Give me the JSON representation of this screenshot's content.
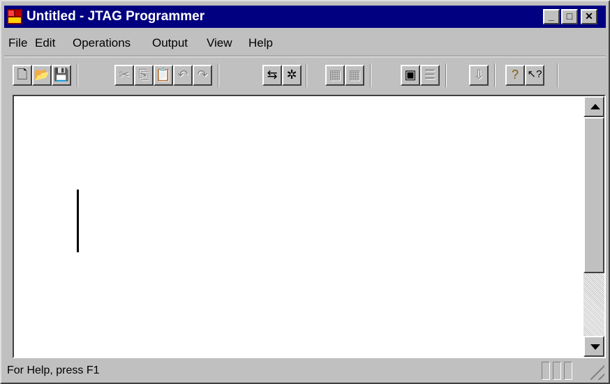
{
  "window": {
    "title": "Untitled - JTAG Programmer"
  },
  "title_buttons": {
    "minimize": "_",
    "maximize": "□",
    "close": "✕"
  },
  "menu": [
    {
      "label": "File"
    },
    {
      "label": "Edit"
    },
    {
      "label": "Operations"
    },
    {
      "label": "Output"
    },
    {
      "label": "View"
    },
    {
      "label": "Help"
    }
  ],
  "toolbar": [
    {
      "icon": "new-file-icon",
      "glyph": "🗋",
      "enabled": true
    },
    {
      "icon": "open-folder-icon",
      "glyph": "📂",
      "enabled": true
    },
    {
      "icon": "save-icon",
      "glyph": "💾",
      "enabled": true
    },
    {
      "icon": "cut-icon",
      "glyph": "✂",
      "enabled": false
    },
    {
      "icon": "copy-icon",
      "glyph": "⎘",
      "enabled": false
    },
    {
      "icon": "paste-icon",
      "glyph": "📋",
      "enabled": false
    },
    {
      "icon": "undo-icon",
      "glyph": "↶",
      "enabled": false
    },
    {
      "icon": "redo-icon",
      "glyph": "↷",
      "enabled": false
    },
    {
      "icon": "chain-icon",
      "glyph": "⇆",
      "enabled": true
    },
    {
      "icon": "bug-icon",
      "glyph": "✲",
      "enabled": true
    },
    {
      "icon": "grid-large-icon",
      "glyph": "▦",
      "enabled": false
    },
    {
      "icon": "grid-small-icon",
      "glyph": "▦",
      "enabled": false
    },
    {
      "icon": "chip-icon",
      "glyph": "▣",
      "enabled": true
    },
    {
      "icon": "properties-icon",
      "glyph": "☰",
      "enabled": false
    },
    {
      "icon": "download-icon",
      "glyph": "⇩",
      "enabled": false
    },
    {
      "icon": "help-icon",
      "glyph": "?",
      "enabled": true
    },
    {
      "icon": "context-help-icon",
      "glyph": "↖?",
      "enabled": true
    }
  ],
  "status": {
    "text": "For Help, press F1"
  }
}
